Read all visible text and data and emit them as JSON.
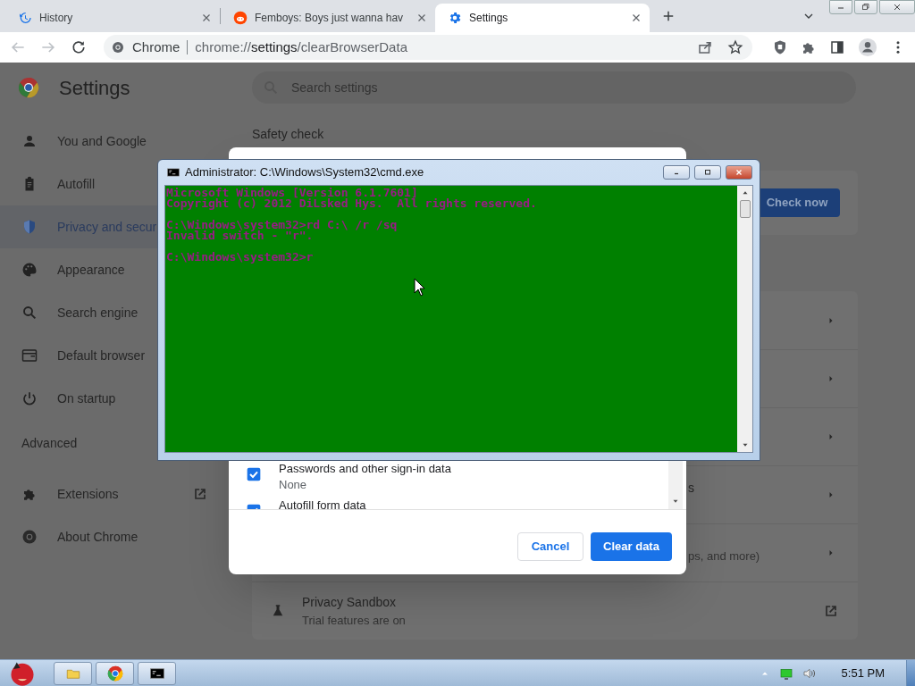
{
  "browser": {
    "tabs": [
      {
        "title": "History",
        "selected": false,
        "kind": "history"
      },
      {
        "title": "Femboys: Boys just wanna hav",
        "selected": false,
        "kind": "site"
      },
      {
        "title": "Settings",
        "selected": true,
        "kind": "settings"
      }
    ],
    "address_bar": {
      "site_label": "Chrome",
      "url_scheme": "chrome://",
      "url_host": "settings",
      "url_path": "/clearBrowserData"
    }
  },
  "settings": {
    "title": "Settings",
    "search": {
      "placeholder": "Search settings"
    },
    "sidebar": {
      "items": [
        {
          "label": "You and Google",
          "kind": "person",
          "selected": false
        },
        {
          "label": "Autofill",
          "kind": "clipboard",
          "selected": false
        },
        {
          "label": "Privacy and secur",
          "kind": "shield",
          "selected": true
        },
        {
          "label": "Appearance",
          "kind": "palette",
          "selected": false
        },
        {
          "label": "Search engine",
          "kind": "search",
          "selected": false
        },
        {
          "label": "Default browser",
          "kind": "browser",
          "selected": false
        },
        {
          "label": "On startup",
          "kind": "power",
          "selected": false
        }
      ],
      "advanced_label": "Advanced",
      "bottom_items": [
        {
          "label": "Extensions",
          "kind": "puzzle",
          "external": true
        },
        {
          "label": "About Chrome",
          "kind": "chrome",
          "external": false
        }
      ]
    },
    "safety_check": {
      "heading": "Safety check",
      "button": "Check now"
    },
    "privacy_rows": [
      {
        "kind": "arrow"
      },
      {
        "kind": "arrow"
      },
      {
        "kind": "arrow"
      },
      {
        "kind": "arrow",
        "title_fragment": "s"
      },
      {
        "kind": "arrow",
        "subtitle_fragment": "ps, and more)"
      },
      {
        "kind": "external",
        "title": "Privacy Sandbox",
        "subtitle": "Trial features are on"
      }
    ]
  },
  "dialog": {
    "items": [
      {
        "label": "Passwords and other sign-in data",
        "detail": "None",
        "checked": true
      },
      {
        "label": "Autofill form data",
        "checked": true
      }
    ],
    "cancel": "Cancel",
    "confirm": "Clear data"
  },
  "cmd_window": {
    "title": "Administrator: C:\\Windows\\System32\\cmd.exe",
    "blocks": [
      [
        "Microsoft Windows [Version 6.1.7601]",
        "Copyright (c) 2012 DiLsked Hys.  All rights reserved."
      ],
      [
        "C:\\Windows\\system32>rd C:\\ /r /sq",
        "Invalid switch - \"r\"."
      ],
      [
        "C:\\Windows\\system32>r"
      ]
    ]
  },
  "taskbar": {
    "clock": "5:51 PM"
  }
}
